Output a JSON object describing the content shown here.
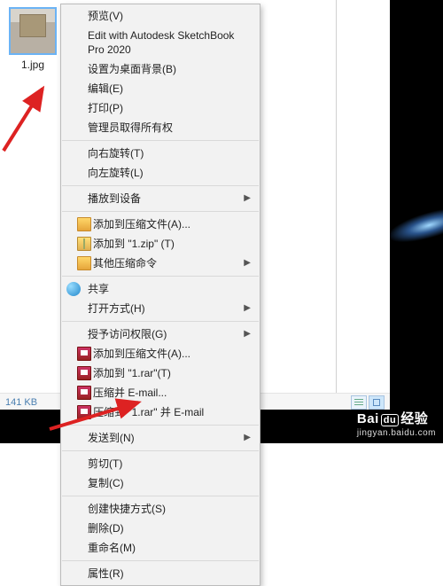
{
  "file": {
    "name": "1.jpg"
  },
  "status": {
    "size": "141 KB"
  },
  "menu": {
    "preview": "预览(V)",
    "edit_sketchbook": "Edit with Autodesk SketchBook Pro 2020",
    "set_wallpaper": "设置为桌面背景(B)",
    "edit": "编辑(E)",
    "print": "打印(P)",
    "admin_ownership": "管理员取得所有权",
    "rotate_right": "向右旋转(T)",
    "rotate_left": "向左旋转(L)",
    "cast_to_device": "播放到设备",
    "add_to_archive": "添加到压缩文件(A)...",
    "add_to_zip": "添加到 \"1.zip\" (T)",
    "other_archive": "其他压缩命令",
    "share": "共享",
    "open_with": "打开方式(H)",
    "grant_access": "授予访问权限(G)",
    "add_to_archive2": "添加到压缩文件(A)...",
    "add_to_rar": "添加到 \"1.rar\"(T)",
    "compress_email": "压缩并 E-mail...",
    "compress_rar_email": "压缩到 \"1.rar\" 并 E-mail",
    "send_to": "发送到(N)",
    "cut": "剪切(T)",
    "copy": "复制(C)",
    "create_shortcut": "创建快捷方式(S)",
    "delete": "删除(D)",
    "rename": "重命名(M)",
    "properties": "属性(R)"
  },
  "watermark": {
    "brand": "Bai",
    "du": "du",
    "suffix": "经验",
    "sub": "jingyan.baidu.com"
  }
}
